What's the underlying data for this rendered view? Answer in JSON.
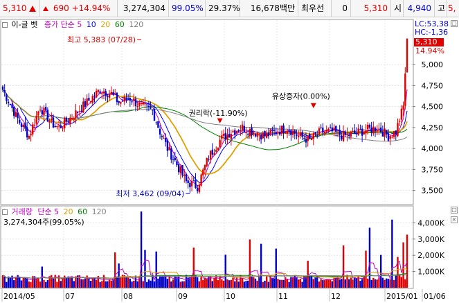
{
  "header": {
    "price": "5,310",
    "change": "690",
    "change_pct": "+14.94%",
    "volume": "3,274,304",
    "vol_ratio": "99.05%",
    "turnover": "29.37%",
    "amount": "16,678백만",
    "best_ask_label": "최우선",
    "best_ask_value": "0",
    "best_bid_value": "5,310",
    "open_label": "시",
    "open_value": "4,940",
    "high_label": "고",
    "high_value": "5,"
  },
  "price_legend": {
    "indicator": "이-글 벳",
    "ma_label": "종가 단순",
    "periods": [
      "5",
      "10",
      "20",
      "60",
      "120"
    ]
  },
  "volume_legend": {
    "title": "거래량",
    "ma_label": "단순",
    "periods": [
      "5",
      "20",
      "60",
      "120"
    ],
    "current": "3,274,304주(99.05%)"
  },
  "colors": {
    "up": "#e00000",
    "down": "#0000c8",
    "ma5": "#c000c0",
    "ma10": "#0000ff",
    "ma20": "#e0a000",
    "ma60": "#008000",
    "ma120": "#808080"
  },
  "right_labels": {
    "lc": "LC:53,38",
    "hc": "HC:-1,36",
    "last_price": "5,310",
    "last_pct": "14.94%"
  },
  "chart_data": [
    {
      "type": "candlestick",
      "yticks": [
        "5,000",
        "4,750",
        "4,500",
        "4,250",
        "4,000",
        "3,750",
        "3,500"
      ],
      "ytick_values": [
        5000,
        4750,
        4500,
        4250,
        4000,
        3750,
        3500
      ],
      "ylim": [
        3340,
        5530
      ],
      "xticks": [
        "2014/05",
        "07",
        "08",
        "09",
        "10",
        "11",
        "12",
        "2015/01",
        "01/06"
      ],
      "annotations": {
        "high": "최고 5,383 (07/28)",
        "low": "최저 3,462 (09/04)",
        "ex_rights": "권리락(-11.90%)",
        "rights_offering": "유상증자(0.00%)"
      }
    },
    {
      "type": "bar",
      "title": "거래량",
      "yticks": [
        "4,000K",
        "3,000K",
        "2,000K",
        "1,000K"
      ],
      "ytick_values": [
        4000000,
        3000000,
        2000000,
        1000000
      ],
      "ylim": [
        0,
        5000000
      ]
    }
  ]
}
